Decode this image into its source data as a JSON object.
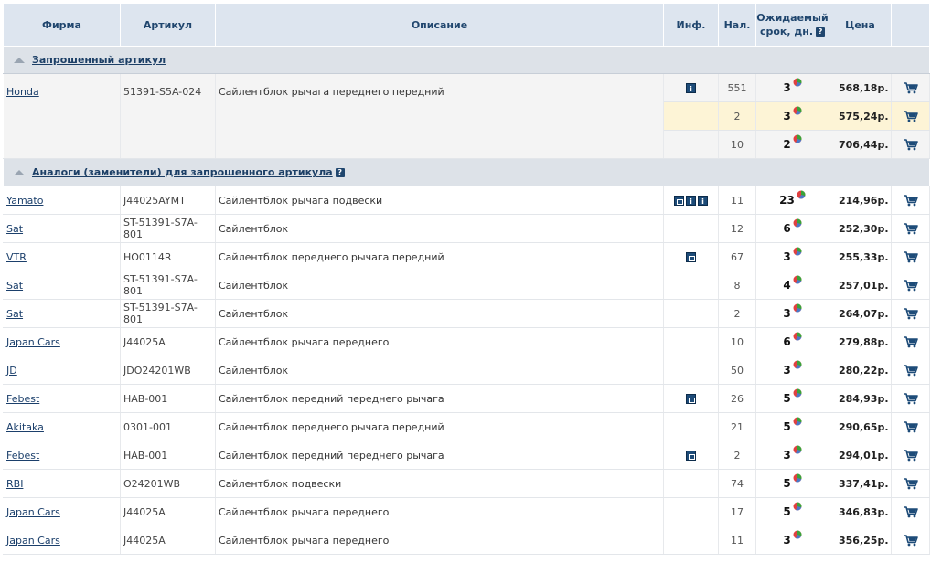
{
  "columns": {
    "firm": "Фирма",
    "article": "Артикул",
    "description": "Описание",
    "info": "Инф.",
    "qty": "Нал.",
    "days_line1": "Ожидаемый",
    "days_line2": "срок, дн.",
    "price": "Цена"
  },
  "sections": {
    "requested": "Запрошенный артикул",
    "analogs": "Аналоги (заменители) для запрошенного артикула"
  },
  "requested": {
    "firm": "Honda",
    "article": "51391-S5A-024",
    "description": "Сайлентблок рычага переднего передний",
    "offers": [
      {
        "qty": "551",
        "days": "3",
        "price": "568,18р."
      },
      {
        "qty": "2",
        "days": "3",
        "price": "575,24р."
      },
      {
        "qty": "10",
        "days": "2",
        "price": "706,44р."
      }
    ]
  },
  "analogs": [
    {
      "firm": "Yamato",
      "article": "J44025AYMT",
      "description": "Сайлентблок рычага подвески",
      "info": [
        "photo",
        "info",
        "info"
      ],
      "qty": "11",
      "days": "23",
      "price": "214,96р."
    },
    {
      "firm": "Sat",
      "article": "ST-51391-S7A-801",
      "description": "Сайлентблок",
      "info": [],
      "qty": "12",
      "days": "6",
      "price": "252,30р."
    },
    {
      "firm": "VTR",
      "article": "HO0114R",
      "description": "Сайлентблок переднего рычага передний",
      "info": [
        "photo"
      ],
      "qty": "67",
      "days": "3",
      "price": "255,33р."
    },
    {
      "firm": "Sat",
      "article": "ST-51391-S7A-801",
      "description": "Сайлентблок",
      "info": [],
      "qty": "8",
      "days": "4",
      "price": "257,01р."
    },
    {
      "firm": "Sat",
      "article": "ST-51391-S7A-801",
      "description": "Сайлентблок",
      "info": [],
      "qty": "2",
      "days": "3",
      "price": "264,07р."
    },
    {
      "firm": "Japan Cars",
      "article": "J44025A",
      "description": "Сайлентблок рычага переднего",
      "info": [],
      "qty": "10",
      "days": "6",
      "price": "279,88р."
    },
    {
      "firm": "JD",
      "article": "JDO24201WB",
      "description": "Сайлентблок",
      "info": [],
      "qty": "50",
      "days": "3",
      "price": "280,22р."
    },
    {
      "firm": "Febest",
      "article": "HAB-001",
      "description": "Сайлентблок передний переднего рычага",
      "info": [
        "photo"
      ],
      "qty": "26",
      "days": "5",
      "price": "284,93р."
    },
    {
      "firm": "Akitaka",
      "article": "0301-001",
      "description": "Сайлентблок переднего рычага передний",
      "info": [],
      "qty": "21",
      "days": "5",
      "price": "290,65р."
    },
    {
      "firm": "Febest",
      "article": "HAB-001",
      "description": "Сайлентблок передний переднего рычага",
      "info": [
        "photo"
      ],
      "qty": "2",
      "days": "3",
      "price": "294,01р."
    },
    {
      "firm": "RBI",
      "article": "O24201WB",
      "description": "Сайлентблок подвески",
      "info": [],
      "qty": "74",
      "days": "5",
      "price": "337,41р."
    },
    {
      "firm": "Japan Cars",
      "article": "J44025A",
      "description": "Сайлентблок рычага переднего",
      "info": [],
      "qty": "17",
      "days": "5",
      "price": "346,83р."
    },
    {
      "firm": "Japan Cars",
      "article": "J44025A",
      "description": "Сайлентблок рычага переднего",
      "info": [],
      "qty": "11",
      "days": "3",
      "price": "356,25р."
    }
  ],
  "icons": {
    "help": "help-question-icon",
    "info": "info-icon",
    "photo": "photo-icon",
    "cart": "cart-icon",
    "pie": "pie-chart-icon",
    "collapse": "collapse-triangle-icon"
  },
  "colors": {
    "header_bg": "#dde5ef",
    "header_text": "#20466e",
    "section_bg": "#dde2e8",
    "highlight_row": "#fdf4d6",
    "cart": "#1d4b78"
  }
}
